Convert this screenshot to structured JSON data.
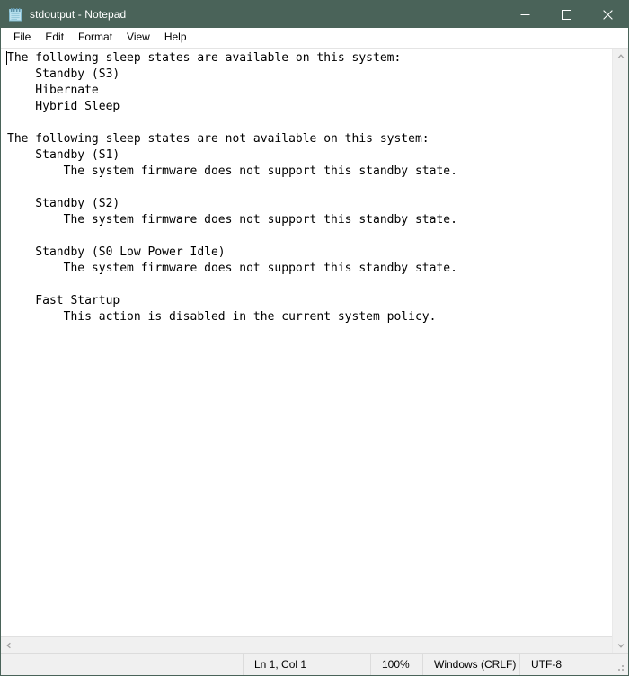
{
  "window": {
    "title": "stdoutput - Notepad",
    "icon": "notepad-icon",
    "titlebar_color": "#4a6359",
    "controls": {
      "minimize": "minimize-icon",
      "maximize": "maximize-icon",
      "close": "close-icon"
    }
  },
  "menubar": {
    "items": [
      {
        "label": "File"
      },
      {
        "label": "Edit"
      },
      {
        "label": "Format"
      },
      {
        "label": "View"
      },
      {
        "label": "Help"
      }
    ]
  },
  "editor": {
    "content": "The following sleep states are available on this system:\n    Standby (S3)\n    Hibernate\n    Hybrid Sleep\n\nThe following sleep states are not available on this system:\n    Standby (S1)\n        The system firmware does not support this standby state.\n\n    Standby (S2)\n        The system firmware does not support this standby state.\n\n    Standby (S0 Low Power Idle)\n        The system firmware does not support this standby state.\n\n    Fast Startup\n        This action is disabled in the current system policy.\n",
    "lines": [
      "The following sleep states are available on this system:",
      "    Standby (S3)",
      "    Hibernate",
      "    Hybrid Sleep",
      "",
      "The following sleep states are not available on this system:",
      "    Standby (S1)",
      "        The system firmware does not support this standby state.",
      "",
      "    Standby (S2)",
      "        The system firmware does not support this standby state.",
      "",
      "    Standby (S0 Low Power Idle)",
      "        The system firmware does not support this standby state.",
      "",
      "    Fast Startup",
      "        This action is disabled in the current system policy."
    ]
  },
  "scrollbars": {
    "vertical": {
      "up_icon": "chevron-up-icon",
      "down_icon": "chevron-down-icon"
    },
    "horizontal": {
      "left_icon": "chevron-left-icon",
      "right_icon": "chevron-right-icon"
    }
  },
  "statusbar": {
    "cursor_position": "Ln 1, Col 1",
    "zoom": "100%",
    "line_ending": "Windows (CRLF)",
    "encoding": "UTF-8"
  }
}
